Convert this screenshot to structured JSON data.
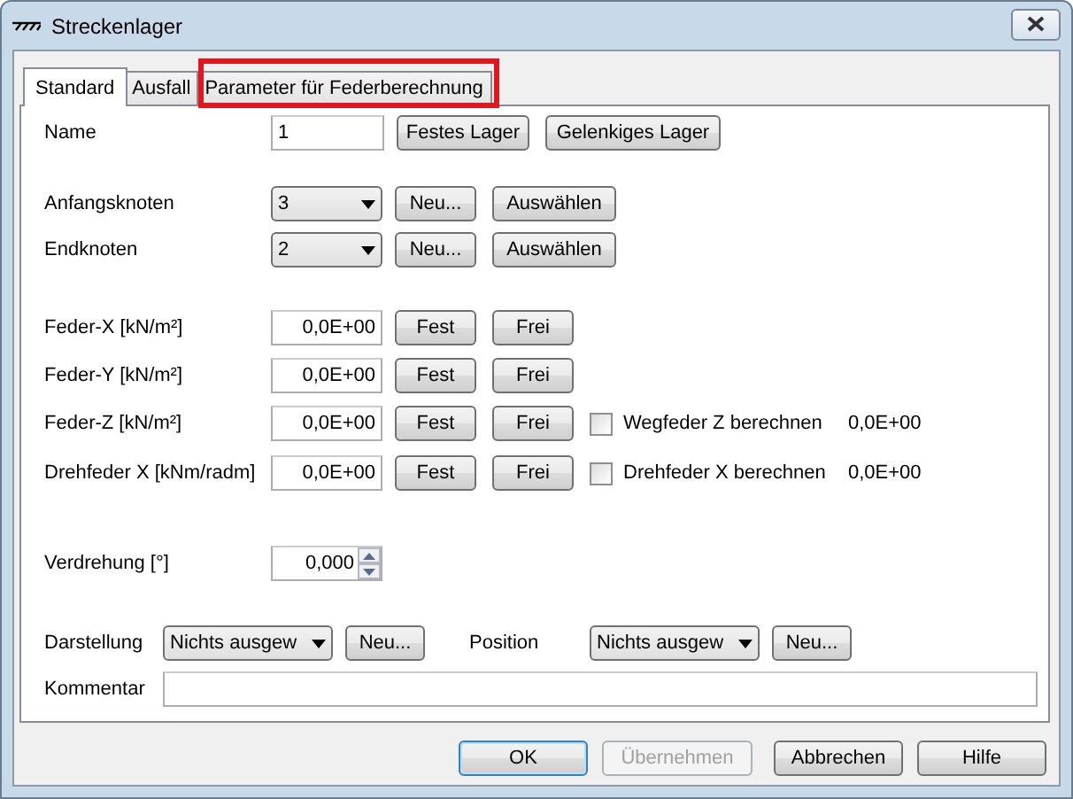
{
  "window": {
    "title": "Streckenlager"
  },
  "tabs": [
    {
      "label": "Standard",
      "selected": true,
      "highlighted": false
    },
    {
      "label": "Ausfall",
      "selected": false,
      "highlighted": false
    },
    {
      "label": "Parameter für Federberechnung",
      "selected": false,
      "highlighted": true
    }
  ],
  "name_row": {
    "label": "Name",
    "value": "1",
    "buttons": [
      "Festes Lager",
      "Gelenkiges Lager"
    ]
  },
  "node_rows": [
    {
      "label": "Anfangsknoten",
      "value": "3",
      "buttons": [
        "Neu...",
        "Auswählen"
      ]
    },
    {
      "label": "Endknoten",
      "value": "2",
      "buttons": [
        "Neu...",
        "Auswählen"
      ]
    }
  ],
  "spring_rows": [
    {
      "label": "Feder-X [kN/m²]",
      "value": "0,0E+00",
      "buttons": [
        "Fest",
        "Frei"
      ]
    },
    {
      "label": "Feder-Y [kN/m²]",
      "value": "0,0E+00",
      "buttons": [
        "Fest",
        "Frei"
      ]
    },
    {
      "label": "Feder-Z [kN/m²]",
      "value": "0,0E+00",
      "buttons": [
        "Fest",
        "Frei"
      ],
      "checkbox": {
        "label": "Wegfeder Z berechnen",
        "checked": false
      },
      "result": "0,0E+00"
    },
    {
      "label": "Drehfeder X [kNm/radm]",
      "value": "0,0E+00",
      "buttons": [
        "Fest",
        "Frei"
      ],
      "checkbox": {
        "label": "Drehfeder X berechnen",
        "checked": false
      },
      "result": "0,0E+00"
    }
  ],
  "rotation": {
    "label": "Verdrehung [°]",
    "value": "0,000"
  },
  "display_row": [
    {
      "label": "Darstellung",
      "value": "Nichts ausgew",
      "button": "Neu..."
    },
    {
      "label": "Position",
      "value": "Nichts ausgew",
      "button": "Neu..."
    }
  ],
  "comment": {
    "label": "Kommentar"
  },
  "footer_buttons": [
    {
      "label": "OK",
      "default": true,
      "disabled": false
    },
    {
      "label": "Übernehmen",
      "default": false,
      "disabled": true
    },
    {
      "label": "Abbrechen",
      "default": false,
      "disabled": false
    },
    {
      "label": "Hilfe",
      "default": false,
      "disabled": false
    }
  ]
}
